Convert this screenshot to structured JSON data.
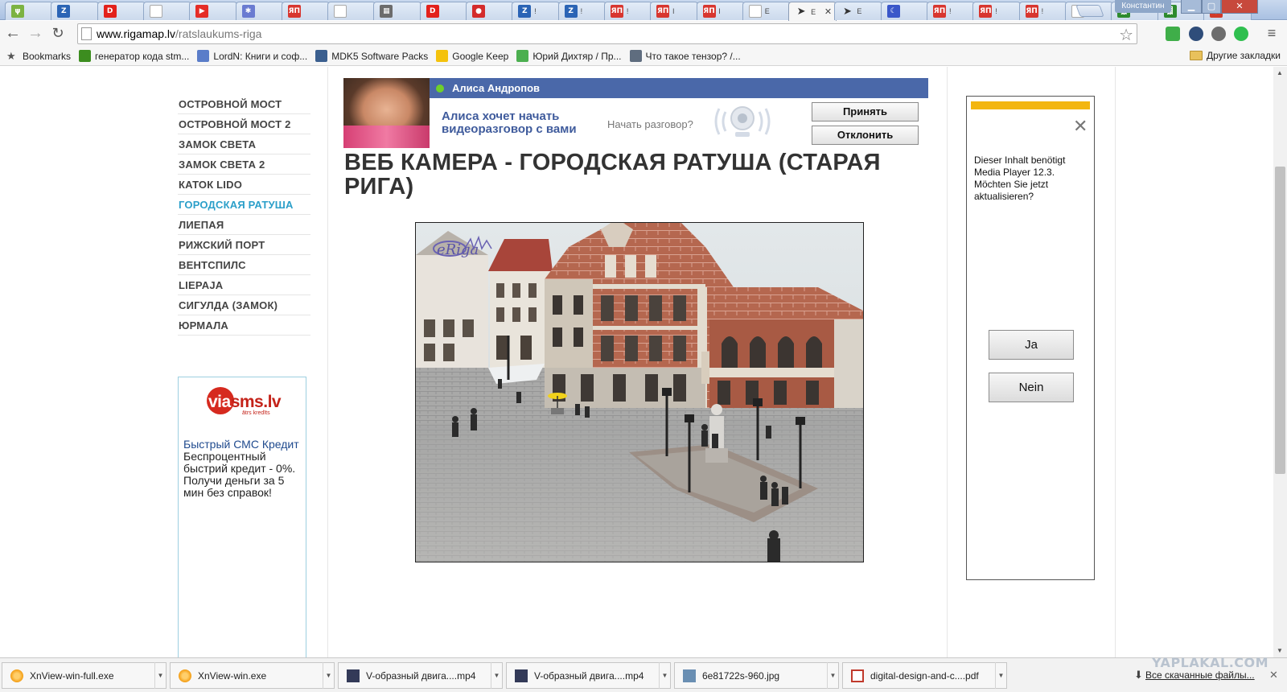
{
  "window": {
    "user_badge": "Константин",
    "min": "▁",
    "max": "▢",
    "close": "✕"
  },
  "tabs": [
    {
      "icon": "leaf-icon",
      "color": "#7cb342",
      "glyph": "ψ",
      "title": ""
    },
    {
      "icon": "blue-z-icon",
      "color": "#2b64b5",
      "glyph": "Z",
      "title": ""
    },
    {
      "icon": "d-red-icon",
      "color": "#e3211b",
      "glyph": "D",
      "title": ""
    },
    {
      "icon": "blank-page-icon",
      "color": "#dddddd",
      "glyph": "",
      "title": ""
    },
    {
      "icon": "youtube-icon",
      "color": "#e52d27",
      "glyph": "▶",
      "title": ""
    },
    {
      "icon": "puzzle-icon",
      "color": "#6a7bd1",
      "glyph": "✱",
      "title": ""
    },
    {
      "icon": "yap-icon",
      "color": "#d8362f",
      "glyph": "ЯП",
      "title": ""
    },
    {
      "icon": "blank-page-icon",
      "color": "#dddddd",
      "glyph": "",
      "title": ""
    },
    {
      "icon": "grid-icon",
      "color": "#6c6c6c",
      "glyph": "▦",
      "title": ""
    },
    {
      "icon": "d-red-icon",
      "color": "#e3211b",
      "glyph": "D",
      "title": ""
    },
    {
      "icon": "red-circle-icon",
      "color": "#d42b2b",
      "glyph": "●",
      "title": ""
    },
    {
      "icon": "blue-z-icon",
      "color": "#2b64b5",
      "glyph": "Z",
      "title": "!"
    },
    {
      "icon": "blue-z-icon",
      "color": "#2b64b5",
      "glyph": "Z",
      "title": "!"
    },
    {
      "icon": "yap-icon",
      "color": "#d8362f",
      "glyph": "ЯП",
      "title": "!"
    },
    {
      "icon": "yap-icon",
      "color": "#d8362f",
      "glyph": "ЯП",
      "title": "l"
    },
    {
      "icon": "yap-icon",
      "color": "#d8362f",
      "glyph": "ЯП",
      "title": "l"
    },
    {
      "icon": "blank-page-icon",
      "color": "#dddddd",
      "glyph": "",
      "title": "E"
    },
    {
      "icon": "navigation-arrow-icon",
      "color": "#333333",
      "glyph": "➤",
      "title": "E"
    },
    {
      "icon": "navigation-arrow-icon",
      "color": "#333333",
      "glyph": "➤",
      "title": "E"
    },
    {
      "icon": "moon-icon",
      "color": "#3a57c9",
      "glyph": "☾",
      "title": ""
    },
    {
      "icon": "yap-icon",
      "color": "#d8362f",
      "glyph": "ЯП",
      "title": "!"
    },
    {
      "icon": "yap-icon",
      "color": "#d8362f",
      "glyph": "ЯП",
      "title": "!"
    },
    {
      "icon": "yap-icon",
      "color": "#d8362f",
      "glyph": "ЯП",
      "title": "!"
    },
    {
      "icon": "blank-page-icon",
      "color": "#dddddd",
      "glyph": "",
      "title": "E"
    },
    {
      "icon": "matrix-icon",
      "color": "#2e8b2e",
      "glyph": "▓",
      "title": ""
    },
    {
      "icon": "matrix-icon",
      "color": "#2e8b2e",
      "glyph": "▓",
      "title": ""
    },
    {
      "icon": "target-icon",
      "color": "#d03a2a",
      "glyph": "◎",
      "title": ""
    }
  ],
  "active_tab_index": 17,
  "address": {
    "host": "www.rigamap.lv",
    "path": "/ratslaukums-riga"
  },
  "bookmarks": [
    {
      "label": "Bookmarks",
      "icon": "star-icon",
      "color": "#555555"
    },
    {
      "label": "генератор кода stm...",
      "icon": "matrix-icon",
      "color": "#3c8d1f"
    },
    {
      "label": "LordN: Книги и соф...",
      "icon": "diamond-icon",
      "color": "#5a7dc9"
    },
    {
      "label": "MDK5 Software Packs",
      "icon": "arrow-box-icon",
      "color": "#3b5f8f"
    },
    {
      "label": "Google Keep",
      "icon": "keep-icon",
      "color": "#f4c20d"
    },
    {
      "label": "Юрий Дихтяр / Пр...",
      "icon": "green-square-icon",
      "color": "#4caf50"
    },
    {
      "label": "Что такое тензор? /...",
      "icon": "gt-icon",
      "color": "#5f6d7f"
    }
  ],
  "other_bookmarks": "Другие закладки",
  "nav": {
    "items": [
      "ОСТРОВНОЙ МОСТ",
      "ОСТРОВНОЙ МОСТ 2",
      "ЗАМОК СВЕТА",
      "ЗАМОК СВЕТА 2",
      "КАТОК LIDO",
      "ГОРОДСКАЯ РАТУША",
      "ЛИЕПАЯ",
      "РИЖСКИЙ ПОРТ",
      "ВЕНТСПИЛС",
      "LIEPAJA",
      "СИГУЛДА (ЗАМОК)",
      "ЮРМАЛА"
    ],
    "active_index": 5,
    "active_color": "#2b9fc9"
  },
  "sms_ad": {
    "logo_via": "via",
    "logo_sms": "sms.lv",
    "logo_sub": "ātrs kredīts",
    "title": "Быстрый СМС Кредит",
    "body": "Беспроцентный быстрий кредит - 0%. Получи деньги за 5 мин без справок!"
  },
  "chat_popup": {
    "name": "Алиса Андропов",
    "invite": "Алиса хочет начать видеоразговор с вами",
    "question": "Начать разговор?",
    "accept": "Принять",
    "decline": "Отклонить",
    "header_color": "#4a68a9"
  },
  "page": {
    "title": "ВЕБ КАМЕРА - ГОРОДСКАЯ РАТУША (СТАРАЯ РИГА)"
  },
  "webcam": {
    "logo": "eRiga"
  },
  "flash_ad": {
    "message": "Dieser Inhalt benötigt Media Player 12.3. Möchten Sie jetzt aktualisieren?",
    "yes": "Ja",
    "no": "Nein",
    "close": "✕",
    "accent": "#f3b610"
  },
  "downloads": [
    {
      "name": "XnView-win-full.exe",
      "icon": "xnview-icon",
      "color": "#f39c12"
    },
    {
      "name": "XnView-win.exe",
      "icon": "xnview-icon",
      "color": "#f39c12"
    },
    {
      "name": "V-образный двига....mp4",
      "icon": "video-file-icon",
      "color": "#333a58"
    },
    {
      "name": "V-образный двига....mp4",
      "icon": "video-file-icon",
      "color": "#333a58"
    },
    {
      "name": "6e81722s-960.jpg",
      "icon": "image-file-icon",
      "color": "#6a8fb3"
    },
    {
      "name": "digital-design-and-c....pdf",
      "icon": "pdf-file-icon",
      "color": "#c0392b"
    }
  ],
  "all_downloads": "Все скачанные файлы...",
  "watermark": "YAPLAKAL.COM"
}
